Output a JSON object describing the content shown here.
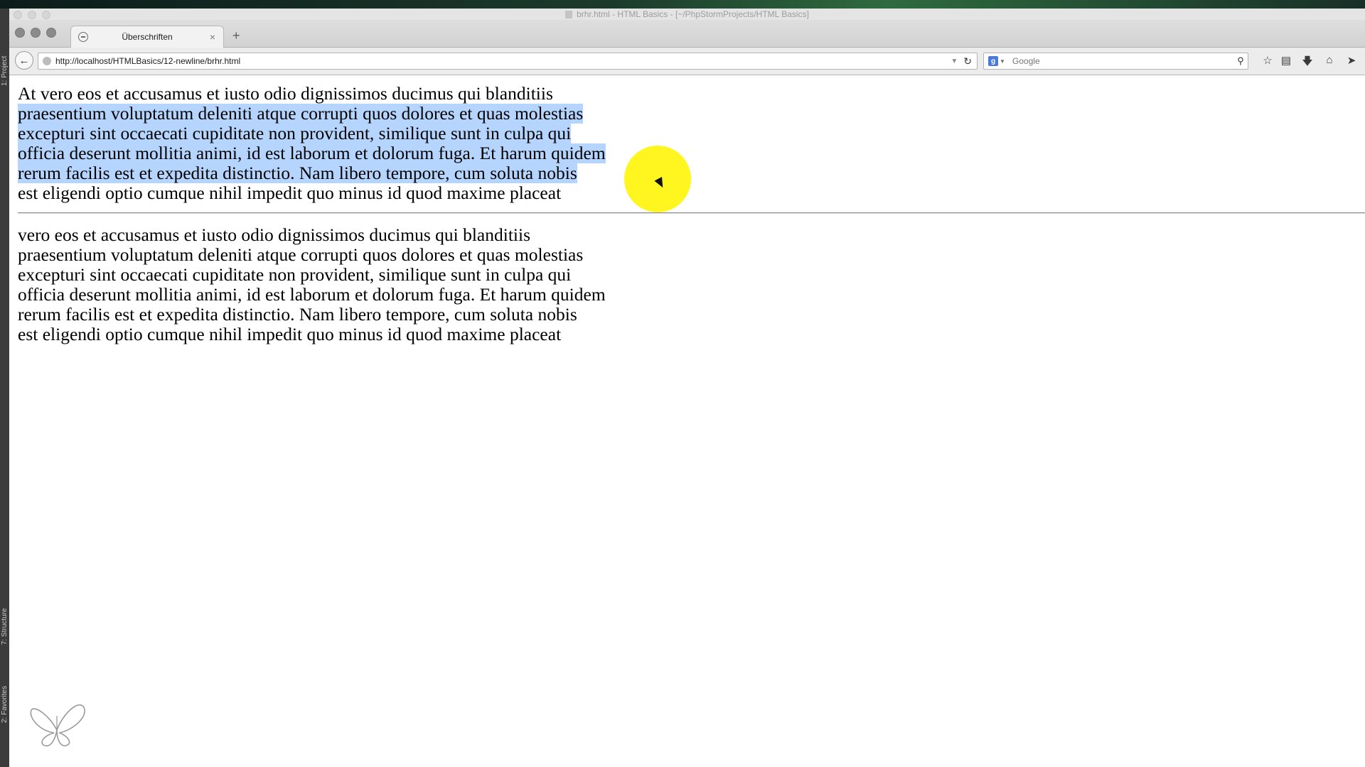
{
  "window": {
    "title": "brhr.html - HTML Basics - [~/PhpStormProjects/HTML Basics]"
  },
  "ide": {
    "left_tabs": [
      "1: Project",
      "7: Structure",
      "2: Favorites"
    ]
  },
  "browser": {
    "tab_label": "Überschriften",
    "tab_close": "×",
    "new_tab": "+",
    "url": "http://localhost/HTMLBasics/12-newline/brhr.html",
    "search_engine_icon": "g",
    "search_placeholder": "Google"
  },
  "icons": {
    "back": "back-arrow-icon",
    "reload": "reload-icon",
    "search": "magnifier-icon",
    "bookmark": "star-icon",
    "bookmarks_list": "bookmark-list-icon",
    "downloads": "download-arrow-icon",
    "home": "home-icon",
    "share": "share-arrow-icon",
    "logo": "butterfly-logo-icon"
  },
  "page": {
    "paragraph1": [
      "At vero eos et accusamus et iusto odio dignissimos ducimus qui blanditiis",
      "praesentium voluptatum deleniti atque corrupti quos dolores et quas molestias",
      "excepturi sint occaecati cupiditate non provident, similique sunt in culpa qui",
      "officia deserunt mollitia animi, id est laborum et dolorum fuga. Et harum quidem",
      "rerum facilis est et expedita distinctio. Nam libero tempore, cum soluta nobis",
      "est eligendi optio cumque nihil impedit quo minus id quod maxime placeat"
    ],
    "paragraph2": [
      "vero eos et accusamus et iusto odio dignissimos ducimus qui blanditiis",
      "praesentium voluptatum deleniti atque corrupti quos dolores et quas molestias",
      "excepturi sint occaecati cupiditate non provident, similique sunt in culpa qui",
      "officia deserunt mollitia animi, id est laborum et dolorum fuga. Et harum quidem",
      "rerum facilis est et expedita distinctio. Nam libero tempore, cum soluta nobis",
      "est eligendi optio cumque nihil impedit quo minus id quod maxime placeat"
    ]
  },
  "colors": {
    "selection": "#b5d5ff",
    "cursor_highlight": "#fff500"
  }
}
